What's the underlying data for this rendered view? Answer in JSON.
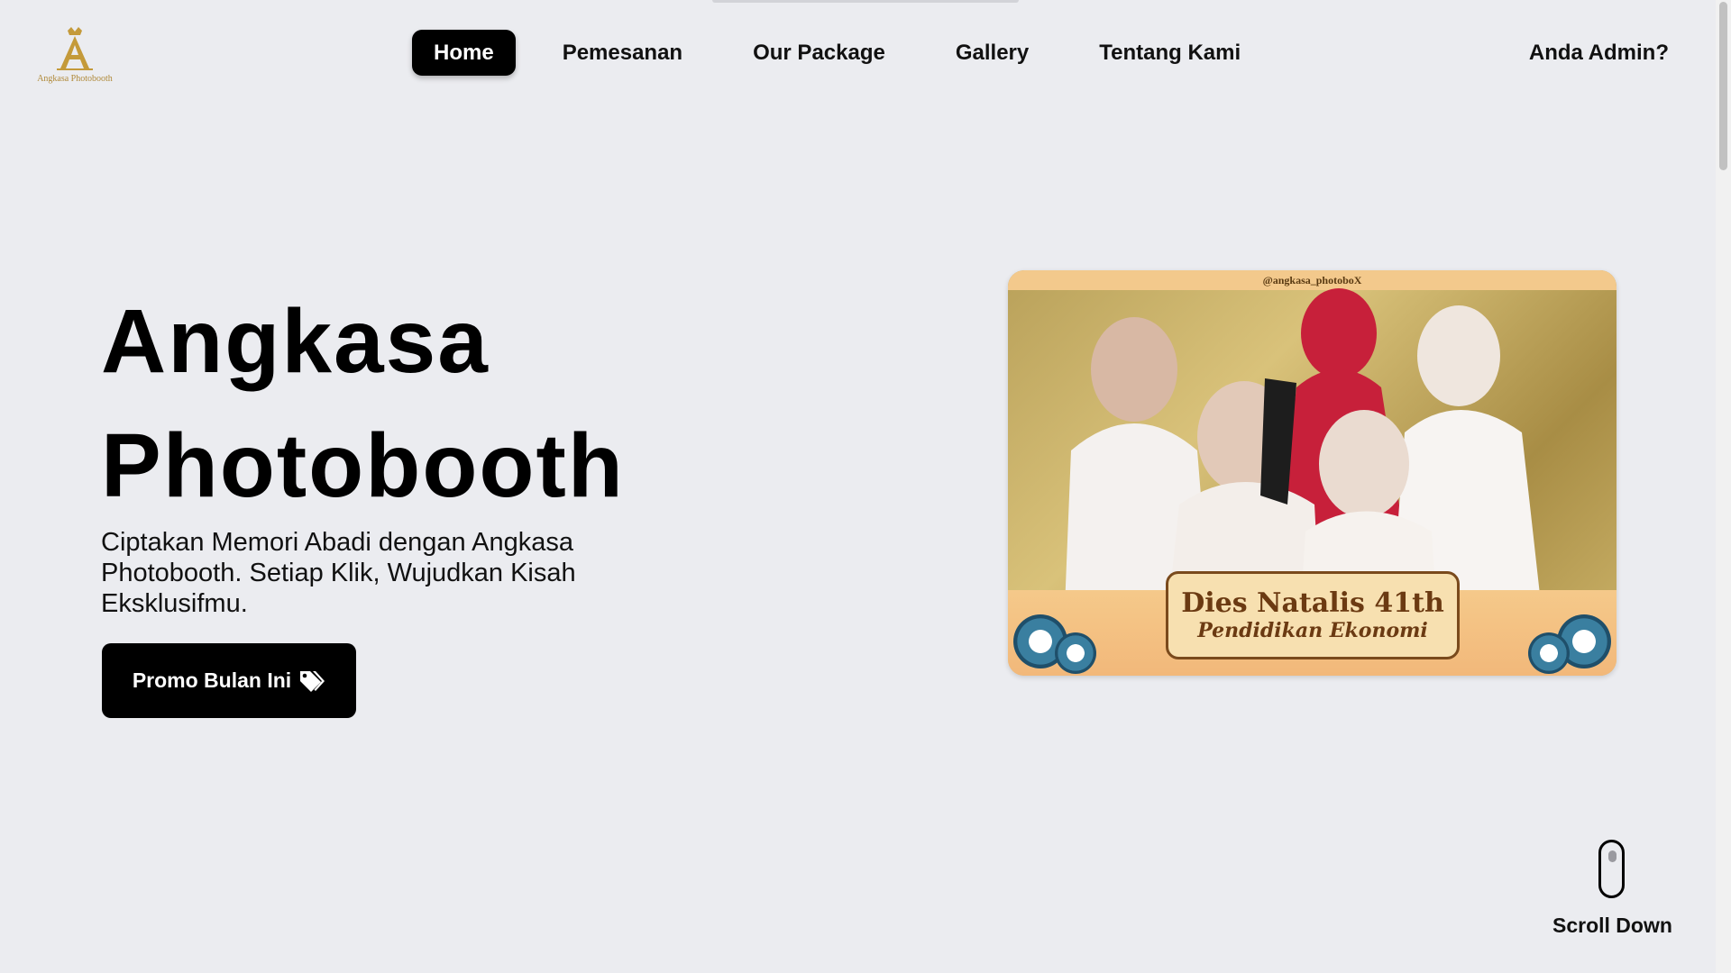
{
  "brand": {
    "logo_text": "Angkasa Photobooth",
    "gold": "#c49a3a"
  },
  "nav": {
    "items": [
      {
        "label": "Home",
        "active": true
      },
      {
        "label": "Pemesanan",
        "active": false
      },
      {
        "label": "Our Package",
        "active": false
      },
      {
        "label": "Gallery",
        "active": false
      },
      {
        "label": "Tentang Kami",
        "active": false
      }
    ],
    "admin_label": "Anda Admin?"
  },
  "hero": {
    "title_line1": "Angkasa",
    "title_line2": "Photobooth",
    "subtitle": "Ciptakan Memori Abadi dengan Angkasa Photobooth. Setiap Klik, Wujudkan Kisah Eksklusifmu.",
    "promo_label": "Promo Bulan Ini",
    "promo_icon": "tags-icon"
  },
  "photo": {
    "handle": "@angkasa_photoboX",
    "banner_line1": "Dies Natalis 41th",
    "banner_line2": "Pendidikan Ekonomi"
  },
  "scroll": {
    "label": "Scroll Down",
    "icon": "mouse-icon"
  },
  "colors": {
    "background": "#ebecf0",
    "primary": "#000000",
    "text": "#111111"
  }
}
